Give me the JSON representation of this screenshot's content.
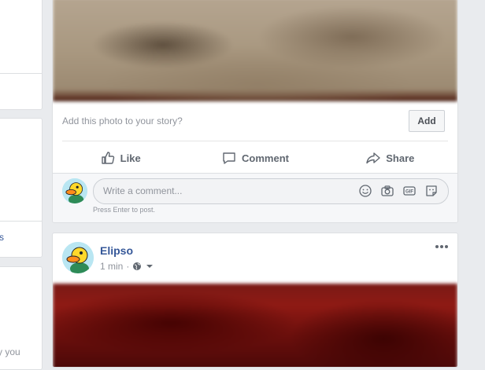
{
  "post1": {
    "story_prompt": "Add this photo to your story?",
    "add_label": "Add",
    "actions": {
      "like": "Like",
      "comment": "Comment",
      "share": "Share"
    },
    "comment_placeholder": "Write a comment...",
    "press_enter": "Press Enter to post."
  },
  "post2": {
    "author": "Elipso",
    "time": "1 min",
    "separator": "·"
  },
  "left_column": {
    "link_text": "s",
    "partial_text": "y you"
  },
  "colors": {
    "background": "#e9ebee",
    "link_blue": "#365899",
    "muted_text": "#90949c",
    "action_text": "#606770"
  },
  "icons": [
    "like-icon",
    "comment-icon",
    "share-icon",
    "emoji-icon",
    "camera-icon",
    "gif-icon",
    "sticker-icon",
    "globe-icon",
    "dropdown-caret-icon",
    "more-icon",
    "duck-avatar"
  ]
}
